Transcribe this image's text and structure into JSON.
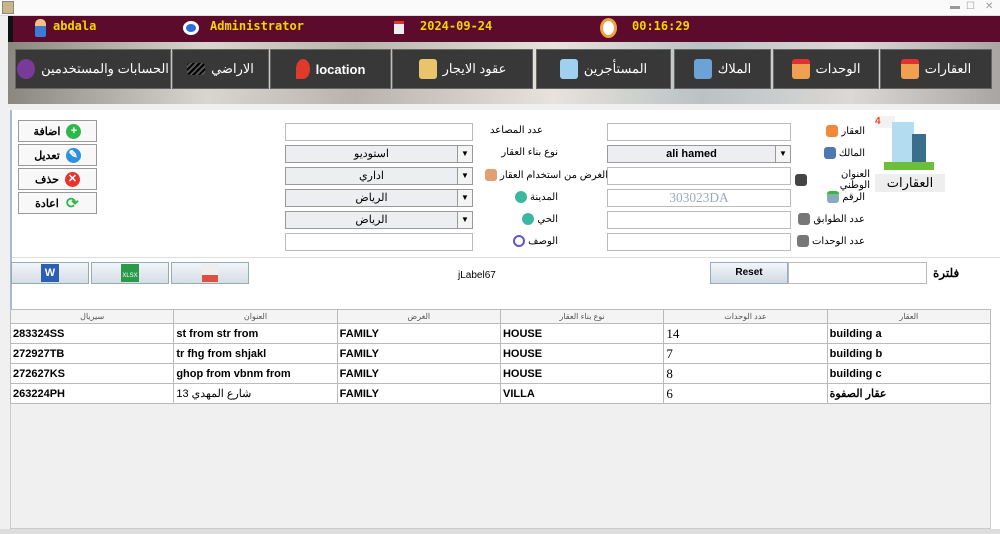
{
  "header": {
    "user": "abdala",
    "role": "Administrator",
    "date": "2024-09-24",
    "time": "00:16:29"
  },
  "nav": [
    {
      "label": "الحسابات والمستخدمين",
      "icon": "users-icon"
    },
    {
      "label": "الاراضي",
      "icon": "land-icon"
    },
    {
      "label": "location",
      "icon": "location-pin-icon"
    },
    {
      "label": "عقود الايجار",
      "icon": "contract-icon"
    },
    {
      "label": "المستأجرين",
      "icon": "tenant-icon"
    },
    {
      "label": "الملاك",
      "icon": "owner-icon"
    },
    {
      "label": "الوحدات",
      "icon": "house-icon"
    },
    {
      "label": "العقارات",
      "icon": "house-icon"
    }
  ],
  "actions": {
    "add": "اضافة",
    "edit": "تعديل",
    "delete": "حذف",
    "refresh": "اعادة"
  },
  "form": {
    "property_label": "العقار",
    "property_value": "",
    "owner_label": "المالك",
    "owner_value": "ali hamed",
    "national_address_label": "العنوان الوطني",
    "national_address_value": "",
    "number_label": "الرقم",
    "number_value": "303023DA",
    "floors_label": "عدد الطوابق",
    "floors_value": "",
    "units_label": "عدد الوحدات",
    "units_value": "",
    "elevators_label": "عدد المصاعد",
    "elevators_value": "",
    "building_type_label": "نوع بناء العقار",
    "building_type_value": "استوديو",
    "usage_label": "الغرض من استخدام العقار",
    "usage_value": "اداري",
    "city_label": "المدينة",
    "city_value": "الرياض",
    "district_label": "الحي",
    "district_value": "الرياض",
    "description_label": "الوصف",
    "description_value": ""
  },
  "badge": {
    "count": "4",
    "label": "العقارات"
  },
  "toolbar": {
    "jlabel": "jLabel67",
    "reset": "Reset",
    "filter_label": "فلترة",
    "filter_value": ""
  },
  "table": {
    "columns": [
      "سيريال",
      "العنوان",
      "الغرض",
      "نوع بناء العقار",
      "عدد الوحدات",
      "العقار"
    ],
    "rows": [
      [
        "283324SS",
        "st from str from",
        "FAMILY",
        "HOUSE",
        "14",
        "building a"
      ],
      [
        "272927TB",
        "tr fhg from shjakl",
        "FAMILY",
        "HOUSE",
        "7",
        "building b"
      ],
      [
        "272627KS",
        "ghop from vbnm from",
        "FAMILY",
        "HOUSE",
        "8",
        "building c"
      ],
      [
        "263224PH",
        "13 شارع المهدي",
        "FAMILY",
        "VILLA",
        "6",
        "عقار الصفوة"
      ]
    ]
  }
}
